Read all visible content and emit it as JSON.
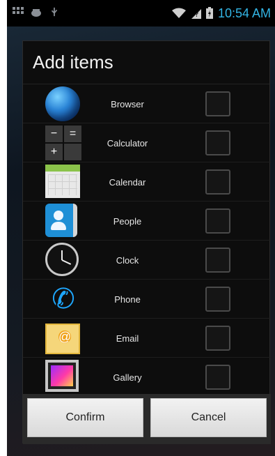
{
  "status_bar": {
    "time": "10:54 AM",
    "icons": [
      "grid-icon",
      "android-icon",
      "usb-icon",
      "wifi-icon",
      "no-sim-icon",
      "battery-icon"
    ]
  },
  "dialog": {
    "title": "Add items",
    "items": [
      {
        "label": "Browser",
        "icon": "browser-icon",
        "checked": false
      },
      {
        "label": "Calculator",
        "icon": "calculator-icon",
        "checked": false
      },
      {
        "label": "Calendar",
        "icon": "calendar-icon",
        "checked": false
      },
      {
        "label": "People",
        "icon": "people-icon",
        "checked": false
      },
      {
        "label": "Clock",
        "icon": "clock-icon",
        "checked": false
      },
      {
        "label": "Phone",
        "icon": "phone-icon",
        "checked": false
      },
      {
        "label": "Email",
        "icon": "email-icon",
        "checked": false
      },
      {
        "label": "Gallery",
        "icon": "gallery-icon",
        "checked": false
      }
    ],
    "confirm_label": "Confirm",
    "cancel_label": "Cancel"
  },
  "colors": {
    "accent": "#33b5e5",
    "dialog_bg": "#0d0d0d",
    "button_bg": "#e6e6e6"
  }
}
